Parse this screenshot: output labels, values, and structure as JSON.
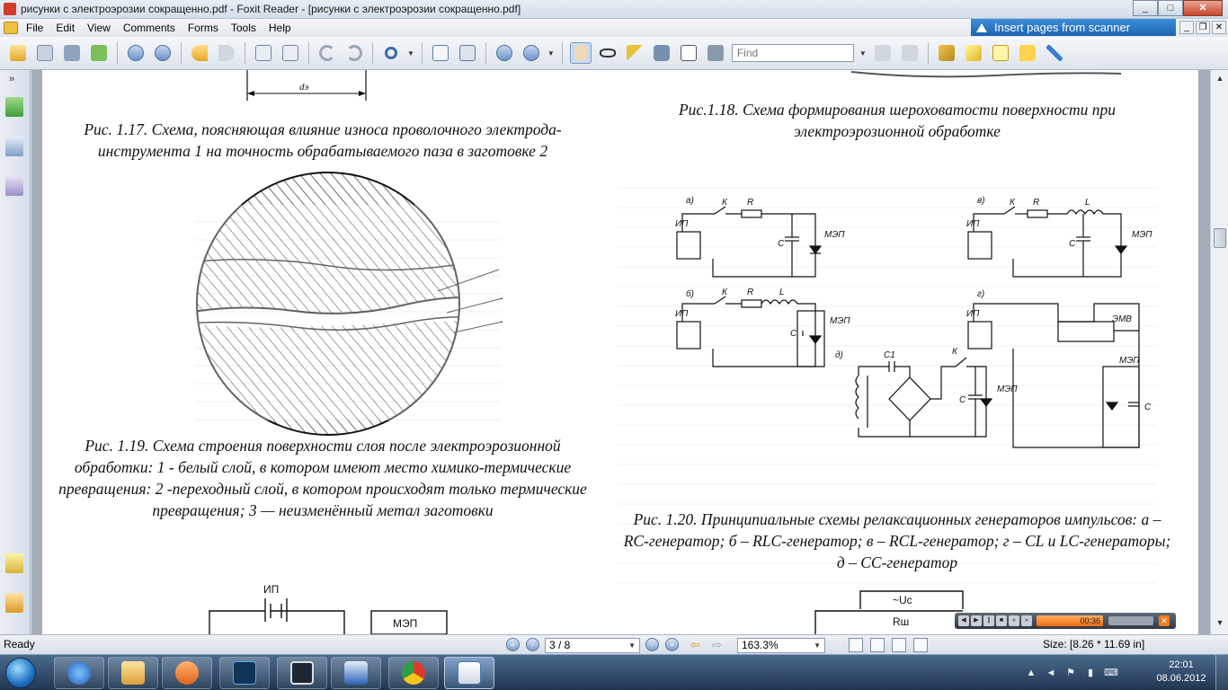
{
  "window": {
    "title": "рисунки с электроэрозии сокращенно.pdf - Foxit Reader - [рисунки с электроэрозии сокращенно.pdf]",
    "controls": {
      "minimize": "_",
      "maximize": "□",
      "close": "✕"
    }
  },
  "menu": {
    "items": [
      "File",
      "Edit",
      "View",
      "Comments",
      "Forms",
      "Tools",
      "Help"
    ],
    "banner": "Insert pages from scanner",
    "mdi_controls": {
      "minimize": "_",
      "restore": "❐",
      "close": "✕"
    }
  },
  "toolbar": {
    "find_placeholder": "Find"
  },
  "document": {
    "captions": {
      "fig_1_17": "Рис. 1.17. Схема, поясняющая влияние износа проволочного электрода-инструмента 1 на точность обрабатываемого паза в заготовке 2",
      "fig_1_18": "Рис.1.18. Схема формирования шероховатости поверхности при электроэрозионной обработке",
      "fig_1_19": "Рис. 1.19. Схема строения поверхности слоя после электроэрозионной обработки: 1 - белый слой, в котором имеют место химико-термические превращения: 2 -переходный слой, в котором происходят только термические превращения; 3 — неизменённый метал заготовки",
      "fig_1_20": "Рис. 1.20. Принципиальные схемы релаксационных генераторов импульсов: а – RC-генератор; б – RLC-генератор; в – RCL-генератор;  г – CL и LC-генераторы; д – CC-генератор"
    },
    "diagram_labels": {
      "top_dim": "dэ",
      "a": "а)",
      "b": "б)",
      "v": "в)",
      "g": "г)",
      "d": "д)",
      "ip": "ИП",
      "k": "К",
      "r": "R",
      "l": "L",
      "c": "С",
      "c1": "С1",
      "mep": "МЭП",
      "emv": "ЭМВ",
      "bottom_ip": "ИП",
      "bottom_mep": "МЭП",
      "uc": "~Uc",
      "rsh": "Rш"
    }
  },
  "media_player": {
    "time": "00:36"
  },
  "status": {
    "ready": "Ready",
    "page_value": "3 / 8",
    "zoom_value": "163.3%",
    "size": "Size: [8.26 * 11.69 in]"
  },
  "clock": {
    "time": "22:01",
    "date": "08.06.2012"
  },
  "colors": {
    "title_bg": "#dbe3ee",
    "banner": "#2a74c6",
    "page": "#ffffff",
    "taskbar": "#2b4563"
  }
}
